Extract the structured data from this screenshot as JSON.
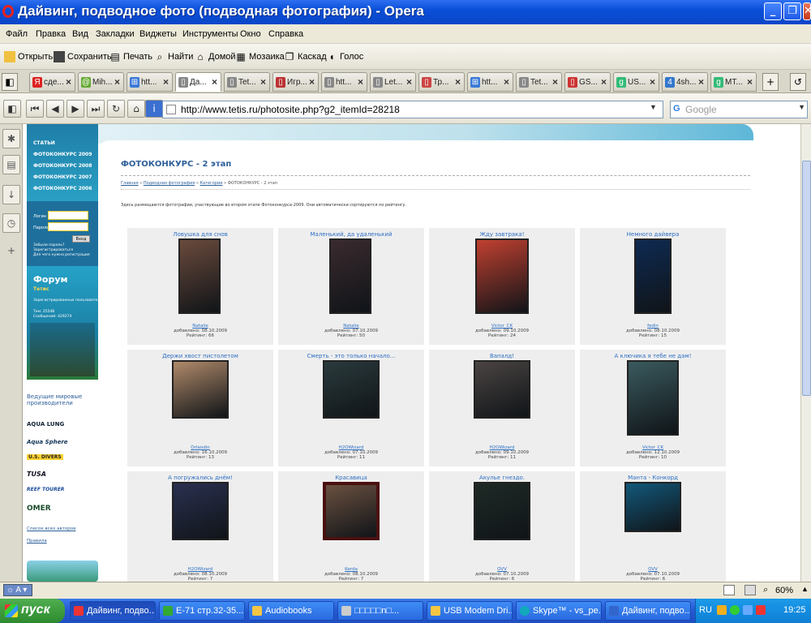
{
  "window": {
    "title": "Дайвинг, подводное фото (подводная фотография) - Opera",
    "minimize": "_",
    "maximize": "❐",
    "close": "✕"
  },
  "menu": [
    "Файл",
    "Правка",
    "Вид",
    "Закладки",
    "Виджеты",
    "Инструменты",
    "Окно",
    "Справка"
  ],
  "toolbar": {
    "open": "Открыть",
    "save": "Сохранить",
    "print": "Печать",
    "find": "Найти",
    "home": "Домой",
    "mosaic": "Мозаика",
    "cascade": "Каскад",
    "voice": "Голос"
  },
  "tabs": [
    {
      "label": "сде...",
      "icon": "yandex-icon"
    },
    {
      "label": "Mih...",
      "icon": "mail-icon"
    },
    {
      "label": "htt...",
      "icon": "windows-icon"
    },
    {
      "label": "Да...",
      "icon": "page-icon"
    },
    {
      "label": "Tet...",
      "icon": "page-icon"
    },
    {
      "label": "Игр...",
      "icon": "page-icon"
    },
    {
      "label": "htt...",
      "icon": "page-icon"
    },
    {
      "label": "Let...",
      "icon": "page-icon"
    },
    {
      "label": "Тр...",
      "icon": "page-icon"
    },
    {
      "label": "htt...",
      "icon": "windows-icon"
    },
    {
      "label": "Tet...",
      "icon": "page-icon"
    },
    {
      "label": "GS...",
      "icon": "page-icon"
    },
    {
      "label": "US...",
      "icon": "google-icon"
    },
    {
      "label": "4sh...",
      "icon": "page-icon"
    },
    {
      "label": "MT...",
      "icon": "google-icon"
    }
  ],
  "address": {
    "url": "http://www.tetis.ru/photosite.php?g2_itemId=28218",
    "search_placeholder": "Google"
  },
  "site": {
    "nav": [
      "СТАТЬИ",
      "ФОТОКОНКУРС 2009",
      "ФОТОКОНКУРС 2008",
      "ФОТОКОНКУРС 2007",
      "ФОТОКОНКУРС 2006"
    ],
    "login_label": "Логин",
    "password_label": "Пароль",
    "login_button": "Вход",
    "forgot": "Забыли пароль?",
    "register": "Зарегистрироваться",
    "remember": "Для чего нужна регистрация",
    "forum_title": "Форум",
    "forum_sub": "Тетис",
    "forum_stats_1": "Зарегистрированных пользователей: 8867",
    "forum_stats_2": "Тем: 25548",
    "forum_stats_3": "Сообщений: 429274",
    "vendors_heading": "Ведущие мировые производители",
    "brands": [
      "AQUA LUNG",
      "Aqua Sphere",
      "U.S. DIVERS",
      "TUSA",
      "REEF TOURER",
      "OMER"
    ],
    "all_authors": "Список всех авторов",
    "rules": "Правила"
  },
  "page": {
    "title": "ФОТОКОНКУРС - 2 этап",
    "breadcrumb": {
      "home": "Главная",
      "photo": "Подводная фотография",
      "cat": "Категории",
      "current": "ФОТОКОНКУРС - 2 этап"
    },
    "description": "Здесь размещаются фотографии, участвующие во втором этапе Фотоконкурса-2009. Они автоматически сортируются по рейтингу."
  },
  "photos": [
    {
      "title": "Ловушка для снов",
      "author": "Natalie",
      "added": "добавлено: 08.10.2009",
      "rating": "Рейтинг: 66",
      "color": "#6a4a3c"
    },
    {
      "title": "Маленький, да удаленький",
      "author": "Natalie",
      "added": "добавлено: 07.10.2009",
      "rating": "Рейтинг: 50",
      "color": "#3a2a2e"
    },
    {
      "title": "Жду завтрака!",
      "author": "Victor_CK",
      "added": "добавлено: 09.10.2009",
      "rating": "Рейтинг: 24",
      "color": "#c04030"
    },
    {
      "title": "Немного дайвера",
      "author": "fedin",
      "added": "добавлено: 08.10.2009",
      "rating": "Рейтинг: 15",
      "color": "#0e2a52"
    },
    {
      "title": "Держи хвост пистолетом",
      "author": "Orlandin",
      "added": "добавлено: 16.10.2009",
      "rating": "Рейтинг: 13",
      "color": "#b08a6a"
    },
    {
      "title": "Смерть - это только начало...",
      "author": "H2OWizard",
      "added": "добавлено: 07.10.2009",
      "rating": "Рейтинг: 11",
      "color": "#2a3a3c"
    },
    {
      "title": "Вапалд!",
      "author": "H2OWizard",
      "added": "добавлено: 09.10.2009",
      "rating": "Рейтинг: 11",
      "color": "#4a4442"
    },
    {
      "title": "А ключика я тебе не дам!",
      "author": "Victor_CK",
      "added": "добавлено: 12.10.2009",
      "rating": "Рейтинг: 10",
      "color": "#3a5a5e"
    },
    {
      "title": "А погружались днём!",
      "author": "H2OWizard",
      "added": "добавлено: 08.10.2009",
      "rating": "Рейтинг: 7",
      "color": "#2a3050"
    },
    {
      "title": "Красавица",
      "author": "Kerda",
      "added": "добавлено: 08.10.2009",
      "rating": "Рейтинг: 7",
      "color": "#6a5040"
    },
    {
      "title": "Акулье гнездо.",
      "author": "OVV",
      "added": "добавлено: 07.10.2009",
      "rating": "Рейтинг: 6",
      "color": "#1e2a26"
    },
    {
      "title": "Манта - Конкорд",
      "author": "OVV",
      "added": "добавлено: 07.10.2009",
      "rating": "Рейтинг: 6",
      "color": "#12587a"
    }
  ],
  "status": {
    "zoom": "60%"
  },
  "taskbar": {
    "start": "пуск",
    "tasks": [
      "Дайвинг, подво...",
      "E-71 стр.32-35....",
      "Audiobooks",
      "□□□□□n□...",
      "USB Modem Dri...",
      "Skype™ - vs_pe...",
      "Дайвинг, подво..."
    ],
    "lang": "RU",
    "clock": "19:25"
  },
  "colors": {
    "accent": "#0a4fd8",
    "link": "#2d6fc4",
    "site_blue": "#1f7ea8"
  }
}
